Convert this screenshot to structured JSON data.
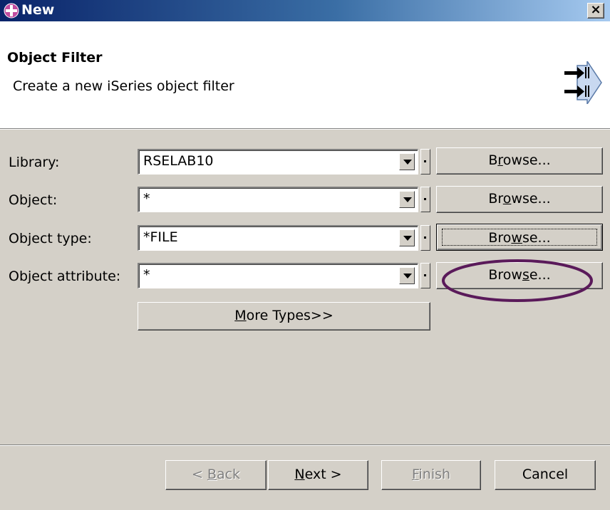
{
  "window": {
    "title": "New",
    "close_label": "×"
  },
  "header": {
    "title": "Object Filter",
    "description": "Create a new iSeries object filter",
    "icon": "wizard-arrow-icon"
  },
  "fields": [
    {
      "label": "Library:",
      "value": "RSELAB10",
      "browse": {
        "pre": "B",
        "key": "r",
        "post": "owse..."
      }
    },
    {
      "label": "Object:",
      "value": "*",
      "browse": {
        "pre": "Br",
        "key": "o",
        "post": "wse..."
      }
    },
    {
      "label": "Object type:",
      "value": "*FILE",
      "browse": {
        "pre": "Bro",
        "key": "w",
        "post": "se..."
      }
    },
    {
      "label": "Object attribute:",
      "value": "*",
      "browse": {
        "pre": "Brow",
        "key": "s",
        "post": "e..."
      }
    }
  ],
  "more_types": {
    "key": "M",
    "post": "ore Types>>"
  },
  "buttons": {
    "back": {
      "pre": "< ",
      "key": "B",
      "post": "ack"
    },
    "next": {
      "key": "N",
      "post": "ext >"
    },
    "finish": {
      "key": "F",
      "post": "inish"
    },
    "cancel": "Cancel"
  },
  "colors": {
    "titlebar_start": "#0a246a",
    "titlebar_end": "#a6caf0",
    "highlight_ellipse": "#5a1a5a",
    "dialog_bg": "#d4d0c8"
  }
}
